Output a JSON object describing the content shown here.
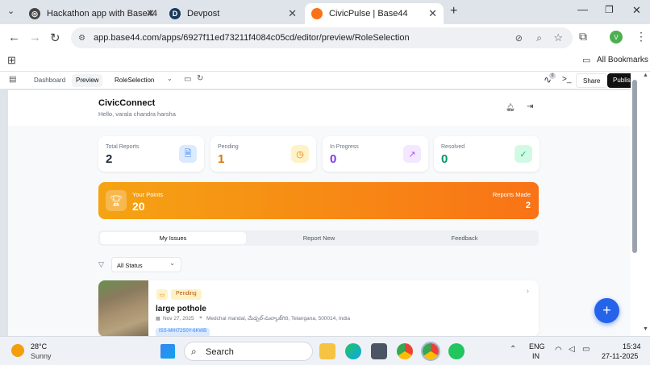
{
  "browser": {
    "tabs": [
      {
        "title": "Hackathon app with Base44",
        "icon_name": "base44-icon"
      },
      {
        "title": "Devpost",
        "icon_name": "devpost-icon"
      },
      {
        "title": "CivicPulse | Base44",
        "icon_name": "civicpulse-icon"
      }
    ],
    "url": "app.base44.com/apps/6927f11ed73211f4084c05cd/editor/preview/RoleSelection",
    "profile_initial": "V",
    "bookmarks_label": "All Bookmarks"
  },
  "editor": {
    "dashboard": "Dashboard",
    "preview": "Preview",
    "page_select": "RoleSelection",
    "share": "Share",
    "publish": "Publish",
    "notif_count": "0"
  },
  "app": {
    "title": "CivicConnect",
    "greeting": "Hello, varala chandra harsha",
    "stats": [
      {
        "label": "Total Reports",
        "value": "2",
        "color": "#1f2937",
        "icon": "document-icon",
        "icon_bg": "#dbeafe",
        "icon_color": "#3b82f6"
      },
      {
        "label": "Pending",
        "value": "1",
        "color": "#d97706",
        "icon": "clock-icon",
        "icon_bg": "#fef3c7",
        "icon_color": "#d97706"
      },
      {
        "label": "In Progress",
        "value": "0",
        "color": "#7c3aed",
        "icon": "trending-up-icon",
        "icon_bg": "#f3e8ff",
        "icon_color": "#a855f7"
      },
      {
        "label": "Resolved",
        "value": "0",
        "color": "#059669",
        "icon": "check-circle-icon",
        "icon_bg": "#d1fae5",
        "icon_color": "#10b981"
      }
    ],
    "points": {
      "label": "Your Points",
      "value": "20",
      "made_label": "Reports Made",
      "made_value": "2"
    },
    "tabs": [
      "My Issues",
      "Report New",
      "Feedback"
    ],
    "filter": "All Status",
    "issue": {
      "status": "Pending",
      "title": "large pothole",
      "date": "Nov 27, 2025",
      "location": "Medchal mandal, మేడ్చల్-మల్కాజ్‌గిరి, Telangana, 500014, India",
      "tracking": "ISS-MIH72S0Y-6KWB"
    }
  },
  "taskbar": {
    "temp": "28°C",
    "weather": "Sunny",
    "search": "Search",
    "lang1": "ENG",
    "lang2": "IN",
    "time": "15:34",
    "date": "27-11-2025"
  }
}
